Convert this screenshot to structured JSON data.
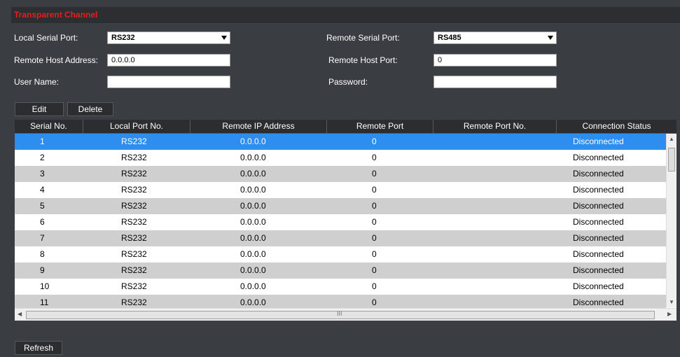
{
  "header": {
    "title": "Transparent Channel"
  },
  "form": {
    "local_serial_port": {
      "label": "Local Serial Port:",
      "value": "RS232"
    },
    "remote_serial_port": {
      "label": "Remote Serial Port:",
      "value": "RS485"
    },
    "remote_host_address": {
      "label": "Remote Host Address:",
      "value": "0.0.0.0"
    },
    "remote_host_port": {
      "label": "Remote Host Port:",
      "value": "0"
    },
    "user_name": {
      "label": "User Name:",
      "value": ""
    },
    "password": {
      "label": "Password:",
      "value": ""
    }
  },
  "toolbar": {
    "edit_label": "Edit",
    "delete_label": "Delete"
  },
  "table": {
    "columns": [
      "Serial No.",
      "Local Port No.",
      "Remote IP Address",
      "Remote Port",
      "Remote Port No.",
      "Connection Status"
    ],
    "rows": [
      [
        "1",
        "RS232",
        "0.0.0.0",
        "0",
        "",
        "Disconnected"
      ],
      [
        "2",
        "RS232",
        "0.0.0.0",
        "0",
        "",
        "Disconnected"
      ],
      [
        "3",
        "RS232",
        "0.0.0.0",
        "0",
        "",
        "Disconnected"
      ],
      [
        "4",
        "RS232",
        "0.0.0.0",
        "0",
        "",
        "Disconnected"
      ],
      [
        "5",
        "RS232",
        "0.0.0.0",
        "0",
        "",
        "Disconnected"
      ],
      [
        "6",
        "RS232",
        "0.0.0.0",
        "0",
        "",
        "Disconnected"
      ],
      [
        "7",
        "RS232",
        "0.0.0.0",
        "0",
        "",
        "Disconnected"
      ],
      [
        "8",
        "RS232",
        "0.0.0.0",
        "0",
        "",
        "Disconnected"
      ],
      [
        "9",
        "RS232",
        "0.0.0.0",
        "0",
        "",
        "Disconnected"
      ],
      [
        "10",
        "RS232",
        "0.0.0.0",
        "0",
        "",
        "Disconnected"
      ],
      [
        "11",
        "RS232",
        "0.0.0.0",
        "0",
        "",
        "Disconnected"
      ]
    ],
    "selected_row": 0
  },
  "scrollbar": {
    "horizontal_grip": "III"
  },
  "footer": {
    "refresh_label": "Refresh"
  },
  "colors": {
    "title_red": "#e02020",
    "selection_blue": "#2e8ef0",
    "panel_dark": "#3a3d42"
  }
}
